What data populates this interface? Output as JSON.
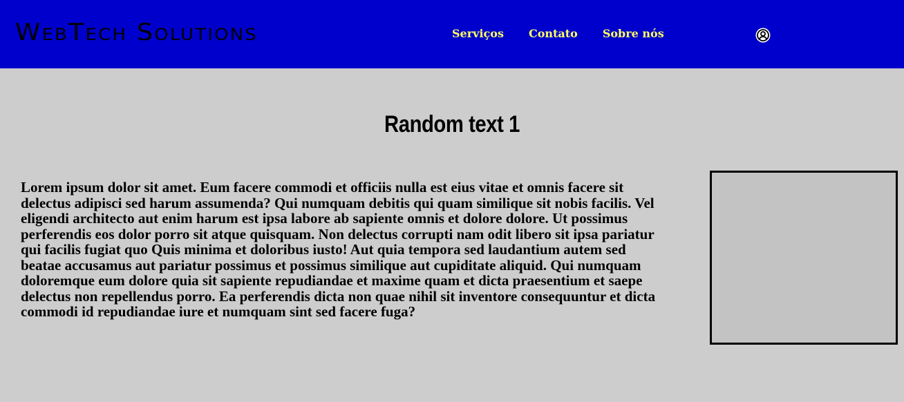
{
  "header": {
    "logo": "WebTech Solutions",
    "nav": [
      {
        "label": "Serviços"
      },
      {
        "label": "Contato"
      },
      {
        "label": "Sobre nós"
      }
    ],
    "user_icon": "user-circle-icon"
  },
  "main": {
    "title": "Random text 1",
    "paragraph": "Lorem ipsum dolor sit amet. Eum facere commodi et officiis nulla est eius vitae et omnis facere sit delectus adipisci sed harum assumenda? Qui numquam debitis qui quam similique sit nobis facilis. Vel eligendi architecto aut enim harum est ipsa labore ab sapiente omnis et dolore dolore. Ut possimus perferendis eos dolor porro sit atque quisquam. Non delectus corrupti nam odit libero sit ipsa pariatur qui facilis fugiat quo Quis minima et doloribus iusto! Aut quia tempora sed laudantium autem sed beatae accusamus aut pariatur possimus et possimus similique aut cupiditate aliquid. Qui numquam doloremque eum dolore quia sit sapiente repudiandae et maxime quam et dicta praesentium et saepe delectus non repellendus porro. Ea perferendis dicta non quae nihil sit inventore consequuntur et dicta commodi id repudiandae iure et numquam sint sed facere fuga?"
  },
  "colors": {
    "header_bg": "#0000cc",
    "nav_text": "#ffff66",
    "page_bg": "#cecdce",
    "box_bg": "#c3c3c3"
  }
}
